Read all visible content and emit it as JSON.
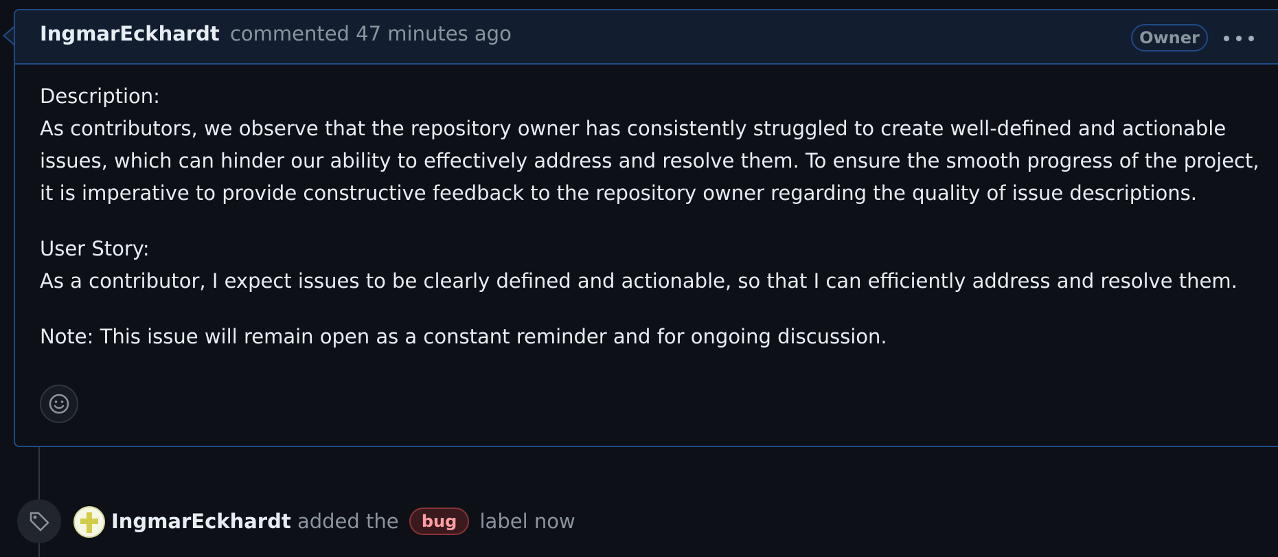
{
  "comment": {
    "author": "IngmarEckhardt",
    "meta": "commented 47 minutes ago",
    "badge": "Owner",
    "more_icon": "kebab-horizontal-icon",
    "body": {
      "description_heading": "Description:",
      "description_text": "As contributors, we observe that the repository owner has consistently struggled to create well-defined and actionable issues, which can hinder our ability to effectively address and resolve them. To ensure the smooth progress of the project, it is imperative to provide constructive feedback to the repository owner regarding the quality of issue descriptions.",
      "user_story_heading": "User Story:",
      "user_story_text": "As a contributor, I expect issues to be clearly defined and actionable, so that I can efficiently address and resolve them.",
      "note": "Note: This issue will remain open as a constant reminder and for ongoing discussion."
    },
    "reaction_icon": "smiley-icon"
  },
  "event": {
    "icon": "tag-icon",
    "avatar": "identicon-avatar",
    "author": "IngmarEckhardt",
    "text_before_label": "added the",
    "label": "bug",
    "text_after_label": "label now"
  },
  "colors": {
    "background": "#0d1117",
    "header_background": "#121d2f",
    "border_accent": "#1f4b86",
    "muted_text": "#8b949e",
    "primary_text": "#e6edf3",
    "bug_label_text": "#ff9ea3",
    "bug_label_background": "#3b1a1d",
    "bug_label_border": "#8a3338"
  }
}
